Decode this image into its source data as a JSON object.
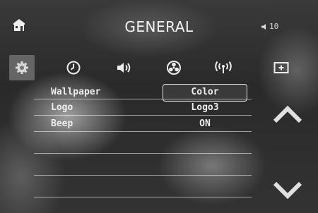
{
  "header": {
    "title": "GENERAL",
    "volume_value": "10"
  },
  "tabs": [
    {
      "id": "settings",
      "icon": "gear-icon",
      "active": true
    },
    {
      "id": "clock",
      "icon": "clock-icon",
      "active": false
    },
    {
      "id": "sound",
      "icon": "speaker-icon",
      "active": false
    },
    {
      "id": "fan",
      "icon": "fan-icon",
      "active": false
    },
    {
      "id": "wireless",
      "icon": "wireless-icon",
      "active": false
    },
    {
      "id": "display",
      "icon": "add-box-icon",
      "active": false
    }
  ],
  "settings": [
    {
      "label": "Wallpaper",
      "value": "Color",
      "selected": true
    },
    {
      "label": "Logo",
      "value": "Logo3",
      "selected": false
    },
    {
      "label": "Beep",
      "value": "ON",
      "selected": false
    },
    {
      "label": "",
      "value": "",
      "selected": false
    },
    {
      "label": "",
      "value": "",
      "selected": false
    },
    {
      "label": "",
      "value": "",
      "selected": false
    }
  ],
  "colors": {
    "text": "#f2f2f2",
    "tab_active_bg": "#787878",
    "divider": "#ffffff"
  }
}
